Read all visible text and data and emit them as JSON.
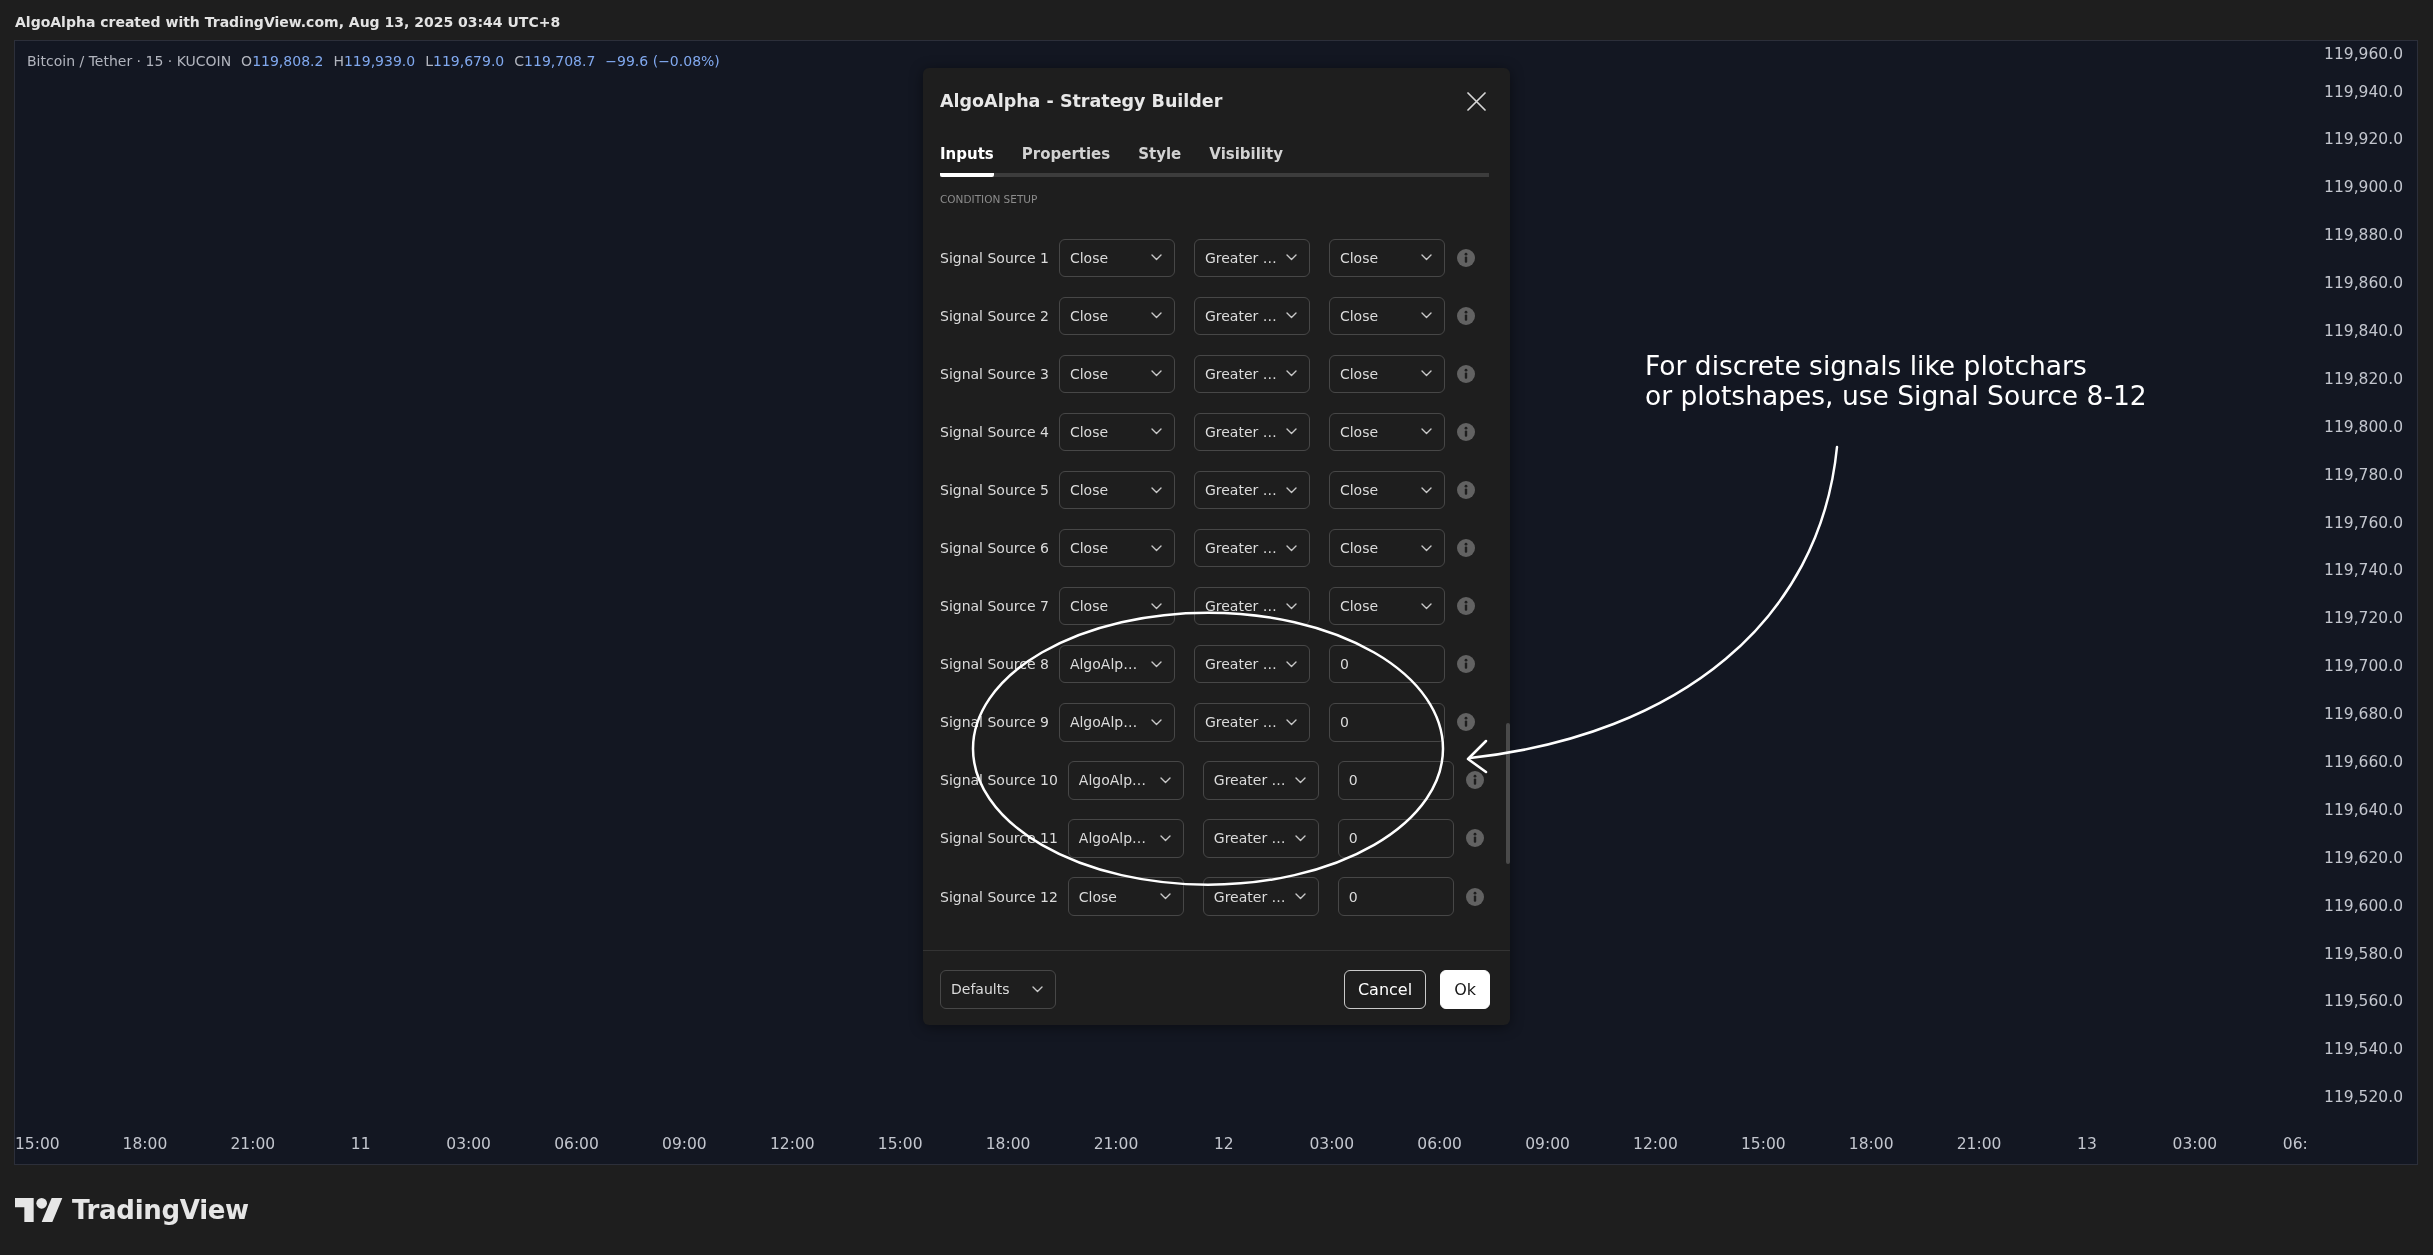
{
  "header": {
    "credit": "AlgoAlpha created with TradingView.com, Aug 13, 2025 03:44 UTC+8"
  },
  "chart": {
    "legend": {
      "symbol": "Bitcoin / Tether · 15 · KUCOIN",
      "ohlc": [
        {
          "label": "O",
          "value": "119,808.2"
        },
        {
          "label": "H",
          "value": "119,939.0"
        },
        {
          "label": "L",
          "value": "119,679.0"
        },
        {
          "label": "C",
          "value": "119,708.7"
        }
      ],
      "change": "−99.6 (−0.08%)"
    },
    "price_axis": [
      "119,960.0",
      "119,940.0",
      "119,920.0",
      "119,900.0",
      "119,880.0",
      "119,860.0",
      "119,840.0",
      "119,820.0",
      "119,800.0",
      "119,780.0",
      "119,760.0",
      "119,740.0",
      "119,720.0",
      "119,700.0",
      "119,680.0",
      "119,660.0",
      "119,640.0",
      "119,620.0",
      "119,600.0",
      "119,580.0",
      "119,560.0",
      "119,540.0",
      "119,520.0"
    ],
    "time_axis": [
      "15:00",
      "18:00",
      "21:00",
      "11",
      "03:00",
      "06:00",
      "09:00",
      "12:00",
      "15:00",
      "18:00",
      "21:00",
      "12",
      "03:00",
      "06:00",
      "09:00",
      "12:00",
      "15:00",
      "18:00",
      "21:00",
      "13",
      "03:00",
      "06:"
    ],
    "annotation": {
      "lines": [
        "For discrete signals like plotchars",
        "or plotshapes, use Signal Source 8-12"
      ]
    }
  },
  "dialog": {
    "title": "AlgoAlpha - Strategy Builder",
    "tabs": [
      {
        "label": "Inputs",
        "selected": true
      },
      {
        "label": "Properties",
        "selected": false
      },
      {
        "label": "Style",
        "selected": false
      },
      {
        "label": "Visibility",
        "selected": false
      }
    ],
    "section_title": "CONDITION SETUP",
    "rows": [
      {
        "label": "Signal Source 1",
        "source": "Close",
        "condition": "Greater …",
        "target": {
          "kind": "select",
          "value": "Close"
        }
      },
      {
        "label": "Signal Source 2",
        "source": "Close",
        "condition": "Greater …",
        "target": {
          "kind": "select",
          "value": "Close"
        }
      },
      {
        "label": "Signal Source 3",
        "source": "Close",
        "condition": "Greater …",
        "target": {
          "kind": "select",
          "value": "Close"
        }
      },
      {
        "label": "Signal Source 4",
        "source": "Close",
        "condition": "Greater …",
        "target": {
          "kind": "select",
          "value": "Close"
        }
      },
      {
        "label": "Signal Source 5",
        "source": "Close",
        "condition": "Greater …",
        "target": {
          "kind": "select",
          "value": "Close"
        }
      },
      {
        "label": "Signal Source 6",
        "source": "Close",
        "condition": "Greater …",
        "target": {
          "kind": "select",
          "value": "Close"
        }
      },
      {
        "label": "Signal Source 7",
        "source": "Close",
        "condition": "Greater …",
        "target": {
          "kind": "select",
          "value": "Close"
        }
      },
      {
        "label": "Signal Source 8",
        "source": "AlgoAlp…",
        "condition": "Greater …",
        "target": {
          "kind": "input",
          "value": "0"
        }
      },
      {
        "label": "Signal Source 9",
        "source": "AlgoAlp…",
        "condition": "Greater …",
        "target": {
          "kind": "input",
          "value": "0"
        }
      },
      {
        "label": "Signal Source 10",
        "source": "AlgoAlp…",
        "condition": "Greater …",
        "target": {
          "kind": "input",
          "value": "0"
        }
      },
      {
        "label": "Signal Source 11",
        "source": "AlgoAlp…",
        "condition": "Greater …",
        "target": {
          "kind": "input",
          "value": "0"
        }
      },
      {
        "label": "Signal Source 12",
        "source": "Close",
        "condition": "Greater …",
        "target": {
          "kind": "input",
          "value": "0"
        }
      }
    ],
    "defaults": "Defaults",
    "buttons": [
      {
        "label": "Cancel",
        "kind": "secondary"
      },
      {
        "label": "Ok",
        "kind": "primary"
      }
    ]
  },
  "branding": {
    "logo_text": "TradingView"
  }
}
